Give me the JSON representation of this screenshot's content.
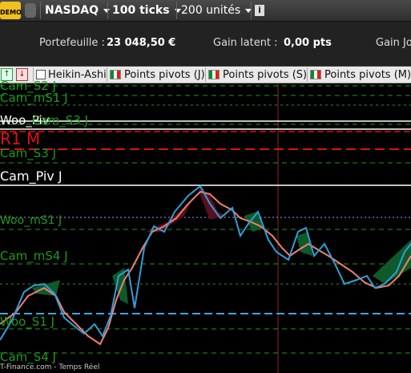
{
  "toolbar": {
    "logo_text": "DEMO",
    "instrument": "NASDAQ",
    "ticks": "100 ticks",
    "units": "200 unités",
    "info_icon": "info-icon"
  },
  "portfolio": {
    "portefeuille_label": "Portefeuille :",
    "portefeuille_value": "23 048,50 €",
    "gain_latent_label": "Gain latent :",
    "gain_latent_value": "0,00 pts",
    "gain_jour_label": "Gain Jo"
  },
  "indicators": {
    "heikin": "Heikin-Ashi",
    "pp_j": "Points pivots (J)",
    "pp_s": "Points pivots (S)",
    "pp_m": "Points pivots (M)"
  },
  "levels": {
    "cam_s2": "Cam_S2 J",
    "cam_ms1": "Cam_mS1 J",
    "woo_piv": "Woo_Piv",
    "cam_s3_top": "Cam_S3 J",
    "r1m": "R1 M",
    "cam_s3": "Cam_S3 J",
    "cam_piv": "Cam_Piv J",
    "woo_ms1": "Woo_mS1 J",
    "cam_ms4": "Cam_mS4 J",
    "woo_s1": "Woo_S1 J",
    "cam_s4": "Cam_S4 J"
  },
  "colors": {
    "green_level": "#1d9a1d",
    "red_level": "#e01010",
    "white_level": "#ffffff",
    "blue_level": "#39a8e0",
    "fast_line": "#2f9fd8",
    "slow_line": "#f08070",
    "cloud_up": "#0e5a2a",
    "cloud_down": "#5a0f1e"
  },
  "footer": "T-Finance.com - Temps Réel"
}
